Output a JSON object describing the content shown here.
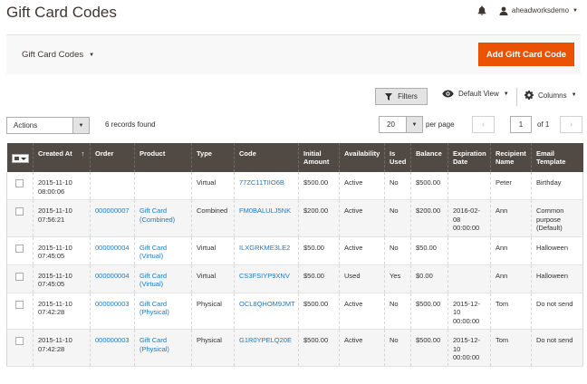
{
  "header": {
    "title": "Gift Card Codes",
    "user": "aheadworksdemo"
  },
  "toolbar": {
    "switcher_label": "Gift Card Codes",
    "add_label": "Add Gift Card Code",
    "filters_label": "Filters",
    "view_label": "Default View",
    "columns_label": "Columns"
  },
  "listing": {
    "actions_label": "Actions",
    "records": "6 records found",
    "per_page_value": "20",
    "per_page_label": "per page",
    "page_value": "1",
    "of_pages": "of 1"
  },
  "columns": [
    "Created At",
    "Order",
    "Product",
    "Type",
    "Code",
    "Initial Amount",
    "Availability",
    "Is Used",
    "Balance",
    "Expiration Date",
    "Recipient Name",
    "Email Template"
  ],
  "rows": [
    {
      "created": "2015-11-10 08:00:06",
      "order": "",
      "product": "",
      "type": "Virtual",
      "code": "77ZC11TIIO6B",
      "initial": "$500.00",
      "availability": "Active",
      "used": "No",
      "balance": "$500.00",
      "expiration": "",
      "recipient": "Peter",
      "template": "Birthday"
    },
    {
      "created": "2015-11-10 07:56:21",
      "order": "000000007",
      "product": "Gift Card (Combined)",
      "type": "Combined",
      "code": "FM0BALULJ5NK",
      "initial": "$200.00",
      "availability": "Active",
      "used": "No",
      "balance": "$200.00",
      "expiration": "2016-02-08 00:00:00",
      "recipient": "Ann",
      "template": "Common purpose (Default)"
    },
    {
      "created": "2015-11-10 07:45:05",
      "order": "000000004",
      "product": "Gift Card (Virtual)",
      "type": "Virtual",
      "code": "ILXGRKME3LE2",
      "initial": "$50.00",
      "availability": "Active",
      "used": "No",
      "balance": "$50.00",
      "expiration": "",
      "recipient": "Ann",
      "template": "Halloween"
    },
    {
      "created": "2015-11-10 07:45:05",
      "order": "000000004",
      "product": "Gift Card (Virtual)",
      "type": "Virtual",
      "code": "CS3FSIYP9XNV",
      "initial": "$50.00",
      "availability": "Used",
      "used": "Yes",
      "balance": "$0.00",
      "expiration": "",
      "recipient": "Ann",
      "template": "Halloween"
    },
    {
      "created": "2015-11-10 07:42:28",
      "order": "000000003",
      "product": "Gift Card (Physical)",
      "type": "Physical",
      "code": "OCL8QHOM9JMT",
      "initial": "$500.00",
      "availability": "Active",
      "used": "No",
      "balance": "$500.00",
      "expiration": "2015-12-10 00:00:00",
      "recipient": "Tom",
      "template": "Do not send"
    },
    {
      "created": "2015-11-10 07:42:28",
      "order": "000000003",
      "product": "Gift Card (Physical)",
      "type": "Physical",
      "code": "G1R0YPELQ20E",
      "initial": "$500.00",
      "availability": "Active",
      "used": "No",
      "balance": "$500.00",
      "expiration": "2015-12-10 00:00:00",
      "recipient": "Tom",
      "template": "Do not send"
    }
  ],
  "colors": {
    "accent": "#eb5202",
    "header_bg": "#514943",
    "link": "#1979c3"
  }
}
